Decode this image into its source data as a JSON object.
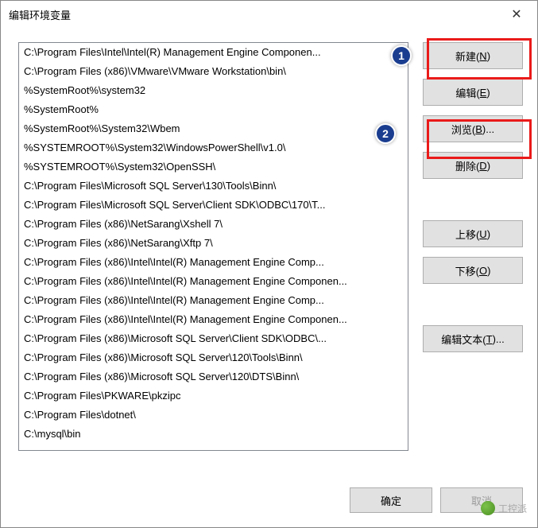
{
  "title": "编辑环境变量",
  "paths": [
    "C:\\Program Files\\Intel\\Intel(R) Management Engine Componen...",
    "C:\\Program Files (x86)\\VMware\\VMware Workstation\\bin\\",
    "%SystemRoot%\\system32",
    "%SystemRoot%",
    "%SystemRoot%\\System32\\Wbem",
    "%SYSTEMROOT%\\System32\\WindowsPowerShell\\v1.0\\",
    "%SYSTEMROOT%\\System32\\OpenSSH\\",
    "C:\\Program Files\\Microsoft SQL Server\\130\\Tools\\Binn\\",
    "C:\\Program Files\\Microsoft SQL Server\\Client SDK\\ODBC\\170\\T...",
    "C:\\Program Files (x86)\\NetSarang\\Xshell 7\\",
    "C:\\Program Files (x86)\\NetSarang\\Xftp 7\\",
    "C:\\Program Files (x86)\\Intel\\Intel(R) Management Engine Comp...",
    "C:\\Program Files (x86)\\Intel\\Intel(R) Management Engine Componen...",
    "C:\\Program Files (x86)\\Intel\\Intel(R) Management Engine Comp...",
    "C:\\Program Files (x86)\\Intel\\Intel(R) Management Engine Componen...",
    "C:\\Program Files (x86)\\Microsoft SQL Server\\Client SDK\\ODBC\\...",
    "C:\\Program Files (x86)\\Microsoft SQL Server\\120\\Tools\\Binn\\",
    "C:\\Program Files (x86)\\Microsoft SQL Server\\120\\DTS\\Binn\\",
    "C:\\Program Files\\PKWARE\\pkzipc",
    "C:\\Program Files\\dotnet\\",
    "C:\\mysql\\bin"
  ],
  "buttons": {
    "new": {
      "prefix": "新建(",
      "hotkey": "N",
      "suffix": ")"
    },
    "edit": {
      "prefix": "编辑(",
      "hotkey": "E",
      "suffix": ")"
    },
    "browse": {
      "prefix": "浏览(",
      "hotkey": "B",
      "suffix": ")..."
    },
    "delete": {
      "prefix": "删除(",
      "hotkey": "D",
      "suffix": ")"
    },
    "moveup": {
      "prefix": "上移(",
      "hotkey": "U",
      "suffix": ")"
    },
    "movedown": {
      "prefix": "下移(",
      "hotkey": "O",
      "suffix": ")"
    },
    "edittext": {
      "prefix": "编辑文本(",
      "hotkey": "T",
      "suffix": ")..."
    },
    "ok": "确定",
    "cancel": "取消"
  },
  "annotations": {
    "one": "1",
    "two": "2"
  },
  "watermark": "工控派"
}
